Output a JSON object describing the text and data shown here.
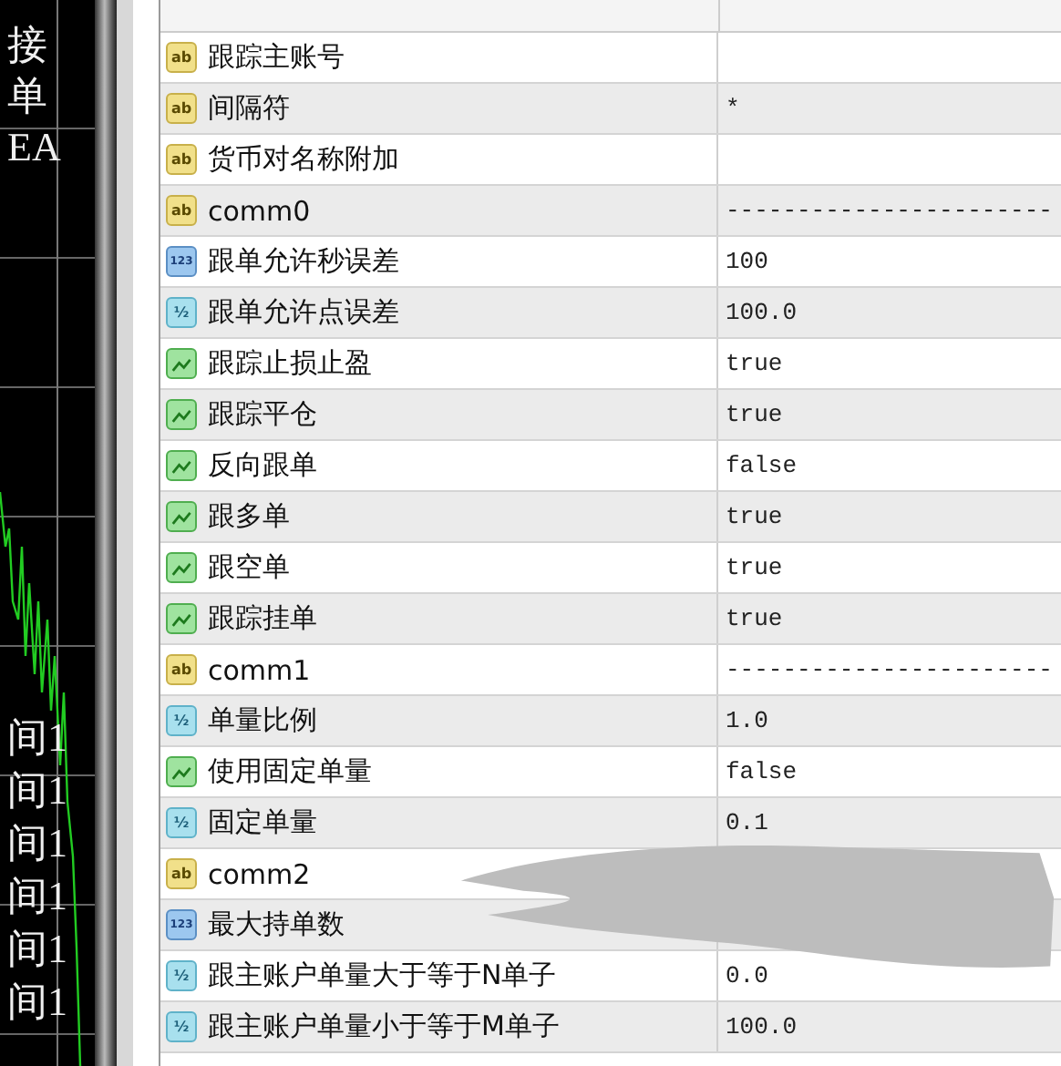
{
  "chart": {
    "top_labels": [
      "接",
      "单",
      "EA"
    ],
    "bottom_labels": [
      "间1",
      "间1",
      "间1",
      "间1",
      "间1",
      "间1"
    ]
  },
  "parameters": [
    {
      "kind": "string",
      "type_label": "ab",
      "name": "跟踪主账号"
    },
    {
      "kind": "string",
      "type_label": "ab",
      "name": "间隔符",
      "value": "*"
    },
    {
      "kind": "string",
      "type_label": "ab",
      "name": "货币对名称附加"
    },
    {
      "kind": "string",
      "type_label": "ab",
      "name": "comm0",
      "value": "-----------------------"
    },
    {
      "kind": "int",
      "type_label": "123",
      "name": "跟单允许秒误差",
      "value": "100"
    },
    {
      "kind": "double",
      "type_label": "½",
      "name": "跟单允许点误差",
      "value": "100.0"
    },
    {
      "kind": "bool",
      "name": "跟踪止损止盈",
      "value": "true"
    },
    {
      "kind": "bool",
      "name": "跟踪平仓",
      "value": "true"
    },
    {
      "kind": "bool",
      "name": "反向跟单",
      "value": "false"
    },
    {
      "kind": "bool",
      "name": "跟多单",
      "value": "true"
    },
    {
      "kind": "bool",
      "name": "跟空单",
      "value": "true"
    },
    {
      "kind": "bool",
      "name": "跟踪挂单",
      "value": "true"
    },
    {
      "kind": "string",
      "type_label": "ab",
      "name": "comm1",
      "value": "-----------------------"
    },
    {
      "kind": "double",
      "type_label": "½",
      "name": "单量比例",
      "value": "1.0"
    },
    {
      "kind": "bool",
      "name": "使用固定单量",
      "value": "false"
    },
    {
      "kind": "double",
      "type_label": "½",
      "name": "固定单量",
      "value": "0.1"
    },
    {
      "kind": "string",
      "type_label": "ab",
      "name": "comm2"
    },
    {
      "kind": "int",
      "type_label": "123",
      "name": "最大持单数"
    },
    {
      "kind": "double",
      "type_label": "½",
      "name": "跟主账户单量大于等于N单子",
      "value": "0.0"
    },
    {
      "kind": "double",
      "type_label": "½",
      "name": "跟主账户单量小于等于M单子",
      "value": "100.0"
    }
  ]
}
